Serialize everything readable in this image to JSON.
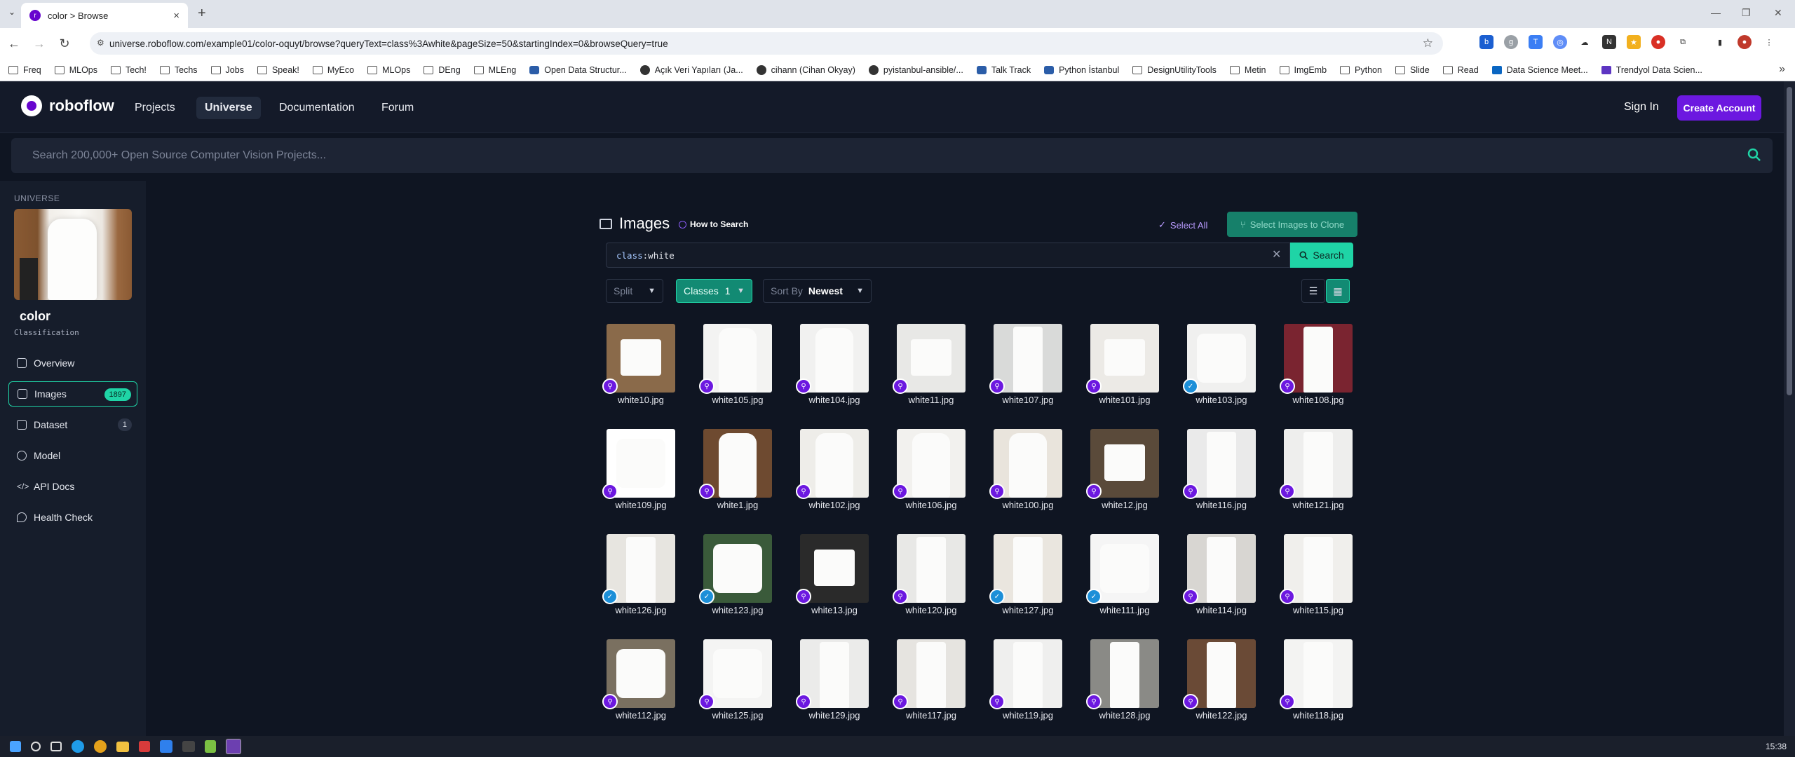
{
  "browser": {
    "tab_title": "color > Browse",
    "url": "universe.roboflow.com/example01/color-oquyt/browse?queryText=class%3Awhite&pageSize=50&startingIndex=0&browseQuery=true",
    "bookmarks": [
      "Freq",
      "MLOps",
      "Tech!",
      "Techs",
      "Jobs",
      "Speak!",
      "MyEco",
      "MLOps",
      "DEng",
      "MLEng",
      "Open Data Structur...",
      "Açık Veri Yapıları (Ja...",
      "cihann (Cihan Okyay)",
      "pyistanbul-ansible/...",
      "Talk Track",
      "Python İstanbul",
      "DesignUtilityTools",
      "Metin",
      "ImgEmb",
      "Python",
      "Slide",
      "Read",
      "Data Science Meet...",
      "Trendyol Data Scien..."
    ]
  },
  "header": {
    "brand": "roboflow",
    "nav": [
      "Projects",
      "Universe",
      "Documentation",
      "Forum"
    ],
    "active_nav": "Universe",
    "sign_in": "Sign In",
    "create_account": "Create Account"
  },
  "search": {
    "placeholder": "Search 200,000+ Open Source Computer Vision Projects..."
  },
  "sidebar": {
    "section": "UNIVERSE",
    "project_name": "color",
    "project_type": "Classification",
    "items": [
      {
        "label": "Overview",
        "badge": ""
      },
      {
        "label": "Images",
        "badge": "1897"
      },
      {
        "label": "Dataset",
        "badge": "1"
      },
      {
        "label": "Model",
        "badge": ""
      },
      {
        "label": "API Docs",
        "badge": ""
      },
      {
        "label": "Health Check",
        "badge": ""
      }
    ]
  },
  "main": {
    "title": "Images",
    "how_to": "How to Search",
    "select_all": "Select All",
    "clone_button": "Select Images to Clone",
    "query_key": "class",
    "query_value": "white",
    "search_button": "Search",
    "split_label": "Split",
    "classes_label": "Classes",
    "classes_count": "1",
    "sort_label": "Sort By",
    "sort_value": "Newest"
  },
  "images": [
    {
      "name": "white10.jpg",
      "badge": "purple",
      "kind": "shorts",
      "bg": "#8a6a4a"
    },
    {
      "name": "white105.jpg",
      "badge": "purple",
      "kind": "dress",
      "bg": "#f3f3f2"
    },
    {
      "name": "white104.jpg",
      "badge": "purple",
      "kind": "dress",
      "bg": "#f1f1f0"
    },
    {
      "name": "white11.jpg",
      "badge": "purple",
      "kind": "shorts",
      "bg": "#e8e8e6"
    },
    {
      "name": "white107.jpg",
      "badge": "purple",
      "kind": "pants",
      "bg": "#d9dad9"
    },
    {
      "name": "white101.jpg",
      "badge": "purple",
      "kind": "shorts",
      "bg": "#eceae6"
    },
    {
      "name": "white103.jpg",
      "badge": "verified",
      "kind": "shirt",
      "bg": "#f0f0ef"
    },
    {
      "name": "white108.jpg",
      "badge": "purple",
      "kind": "pants",
      "bg": "#7a2430"
    },
    {
      "name": "white109.jpg",
      "badge": "purple",
      "kind": "shirt",
      "bg": "#ffffff"
    },
    {
      "name": "white1.jpg",
      "badge": "purple",
      "kind": "dress",
      "bg": "#6e4a30"
    },
    {
      "name": "white102.jpg",
      "badge": "purple",
      "kind": "dress",
      "bg": "#eeede9"
    },
    {
      "name": "white106.jpg",
      "badge": "purple",
      "kind": "dress",
      "bg": "#f2f1ee"
    },
    {
      "name": "white100.jpg",
      "badge": "purple",
      "kind": "dress",
      "bg": "#e9e4dc"
    },
    {
      "name": "white12.jpg",
      "badge": "purple",
      "kind": "shorts",
      "bg": "#5a4a3a"
    },
    {
      "name": "white116.jpg",
      "badge": "purple",
      "kind": "pants",
      "bg": "#eaeaea"
    },
    {
      "name": "white121.jpg",
      "badge": "purple",
      "kind": "pants",
      "bg": "#eeeeed"
    },
    {
      "name": "white126.jpg",
      "badge": "verified",
      "kind": "pants",
      "bg": "#e7e5e0"
    },
    {
      "name": "white123.jpg",
      "badge": "verified",
      "kind": "shirt",
      "bg": "#3a5a3a"
    },
    {
      "name": "white13.jpg",
      "badge": "purple",
      "kind": "shorts",
      "bg": "#2a2a2a"
    },
    {
      "name": "white120.jpg",
      "badge": "purple",
      "kind": "pants",
      "bg": "#e8e8e6"
    },
    {
      "name": "white127.jpg",
      "badge": "verified",
      "kind": "pants",
      "bg": "#eae6df"
    },
    {
      "name": "white111.jpg",
      "badge": "verified",
      "kind": "shirt",
      "bg": "#f5f5f5"
    },
    {
      "name": "white114.jpg",
      "badge": "purple",
      "kind": "pants",
      "bg": "#d8d6d2"
    },
    {
      "name": "white115.jpg",
      "badge": "purple",
      "kind": "pants",
      "bg": "#f0efec"
    },
    {
      "name": "white112.jpg",
      "badge": "purple",
      "kind": "shirt",
      "bg": "#7a7060"
    },
    {
      "name": "white125.jpg",
      "badge": "purple",
      "kind": "shirt",
      "bg": "#f4f4f3"
    },
    {
      "name": "white129.jpg",
      "badge": "purple",
      "kind": "pants",
      "bg": "#ebebea"
    },
    {
      "name": "white117.jpg",
      "badge": "purple",
      "kind": "pants",
      "bg": "#e6e4e0"
    },
    {
      "name": "white119.jpg",
      "badge": "purple",
      "kind": "pants",
      "bg": "#efefee"
    },
    {
      "name": "white128.jpg",
      "badge": "purple",
      "kind": "pants",
      "bg": "#8a8a86"
    },
    {
      "name": "white122.jpg",
      "badge": "purple",
      "kind": "pants",
      "bg": "#6a4a36"
    },
    {
      "name": "white118.jpg",
      "badge": "purple",
      "kind": "pants",
      "bg": "#f3f3f2"
    }
  ],
  "taskbar": {
    "clock": "15:38"
  },
  "colors": {
    "accent": "#1fd4a6",
    "brand": "#6c18e0",
    "bg": "#0f1522"
  }
}
